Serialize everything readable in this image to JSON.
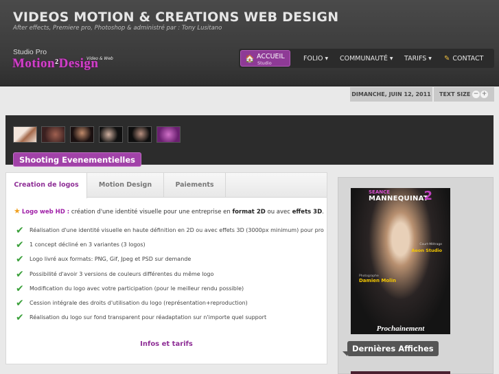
{
  "header": {
    "title": "VIDEOS MOTION & CREATIONS WEB DESIGN",
    "subtitle": "After effects, Premiere pro, Photoshop & administré par : Tony Lusitano",
    "logo": {
      "studio": "Studio Pro",
      "brand_a": "Motion",
      "two": "2",
      "brand_b": "Design",
      "tag": "Video & Web"
    }
  },
  "nav": {
    "home": {
      "label": "ACCUEIL",
      "sublabel": "Studio",
      "icon": "house-icon"
    },
    "items": [
      {
        "label": "FOLIO",
        "caret": "▼"
      },
      {
        "label": "COMMUNAUTÉ",
        "caret": "▼"
      },
      {
        "label": "TARIFS",
        "caret": "▼"
      },
      {
        "label": "CONTACT",
        "icon": "pencil-icon"
      }
    ]
  },
  "datebar": {
    "date": "DIMANCHE, JUIN 12, 2011",
    "text_size_label": "TEXT SIZE",
    "minus": "−",
    "plus": "+"
  },
  "gallery": {
    "thumbnail_count": 6,
    "badge": "Shooting Evenementielles"
  },
  "tabs": [
    {
      "label": "Creation de logos",
      "active": true
    },
    {
      "label": "Motion Design",
      "active": false
    },
    {
      "label": "Paiements",
      "active": false
    }
  ],
  "content": {
    "intro_pink": "Logo web HD :",
    "intro_a": " création d'une identité visuelle pour une entreprise en ",
    "intro_b1": "format 2D",
    "intro_c": " ou avec ",
    "intro_b2": "effets 3D",
    "intro_d": ".",
    "items": [
      "Réalisation d'une identité visuelle en haute définition en 2D ou avec effets 3D (3000px minimum) pour pro",
      "1 concept décliné en 3 variantes (3 logos)",
      "Logo livré  aux formats: PNG, Gif, Jpeg et PSD sur demande",
      "Possibilité d'avoir 3 versions de couleurs différentes du même logo",
      "Modification du logo avec votre participation (pour le meilleur rendu possible)",
      "Cession intégrale des droits d'utilisation du logo (représentation+reproduction)",
      "Réalisation du logo sur fond transparent pour réadaptation sur n'importe quel support"
    ],
    "more_link": "Infos et tarifs"
  },
  "sidebar": {
    "poster": {
      "seance": "SEANCE",
      "title": "MANNEQUINAT",
      "num": "2",
      "court": "Court-Métrage",
      "studio": "Aeon Studio",
      "photo_label": "Photographe",
      "photographer": "Damien Molin",
      "footer": "Prochainement"
    },
    "badge": "Dernières Affiches"
  },
  "colors": {
    "accent": "#8e2e96",
    "check": "#3aa03a",
    "header": "#3a3a3a"
  }
}
